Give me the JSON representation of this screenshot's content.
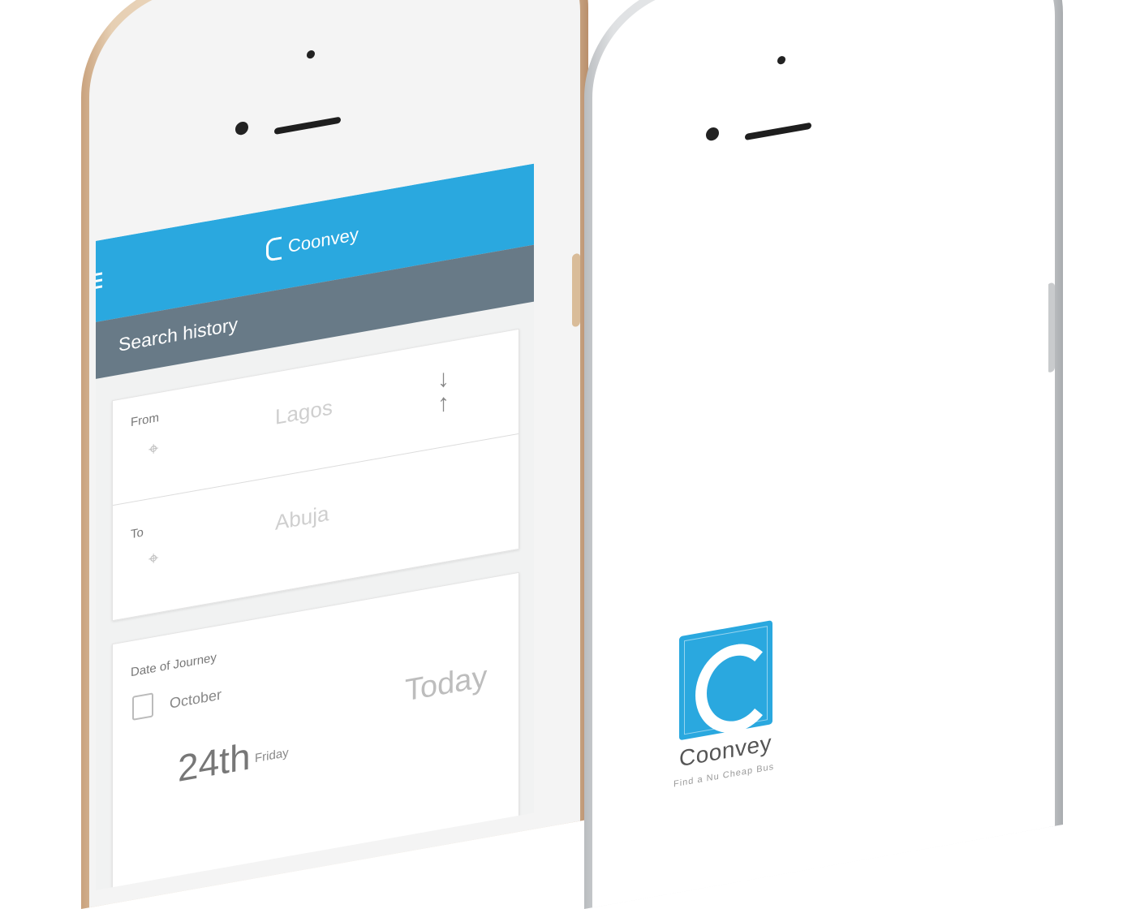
{
  "colors": {
    "accent": "#2aa8df",
    "subbar": "#687a87",
    "gold_phone": "#e6cfb3",
    "silver_phone": "#dfe1e3"
  },
  "left_phone": {
    "app": {
      "brand": "Coonvey",
      "toolbar_icons": [
        "filter-icon",
        "settings-icon"
      ],
      "menu_icon": "hamburger-icon",
      "section_title": "Search history",
      "route": {
        "from_label": "From",
        "from_value": "Lagos",
        "to_label": "To",
        "to_value": "Abuja",
        "swap_icon": "swap-arrows-icon",
        "pin_icon": "location-pin-icon"
      },
      "date": {
        "label": "Date of Journey",
        "month": "October",
        "day": "24th",
        "weekday": "Friday",
        "relative": "Today",
        "calendar_icon": "calendar-icon"
      }
    }
  },
  "right_phone": {
    "splash": {
      "app_name": "Coonvey",
      "tagline": "Find a Nu Cheap Bus"
    }
  }
}
